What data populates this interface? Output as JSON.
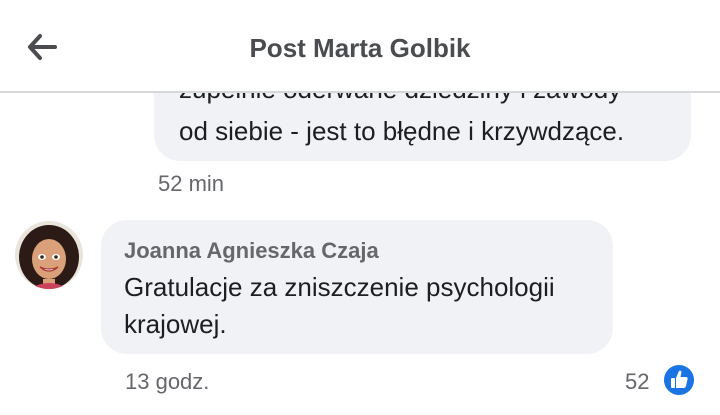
{
  "header": {
    "title": "Post Marta Golbik",
    "back_icon": "arrow-left-icon"
  },
  "previous_comment": {
    "lines": [
      "zupełnie oderwane dziedziny i zawody",
      "od siebie - jest to błędne i krzywdzące."
    ],
    "time": "52 min"
  },
  "comment": {
    "author": "Joanna Agnieszka Czaja",
    "lines": [
      "Gratulacje za zniszczenie psychologii",
      "krajowej."
    ],
    "time": "13 godz.",
    "reaction_count": "52",
    "reaction_icon": "like-icon",
    "reaction_color": "#1b74e4"
  }
}
